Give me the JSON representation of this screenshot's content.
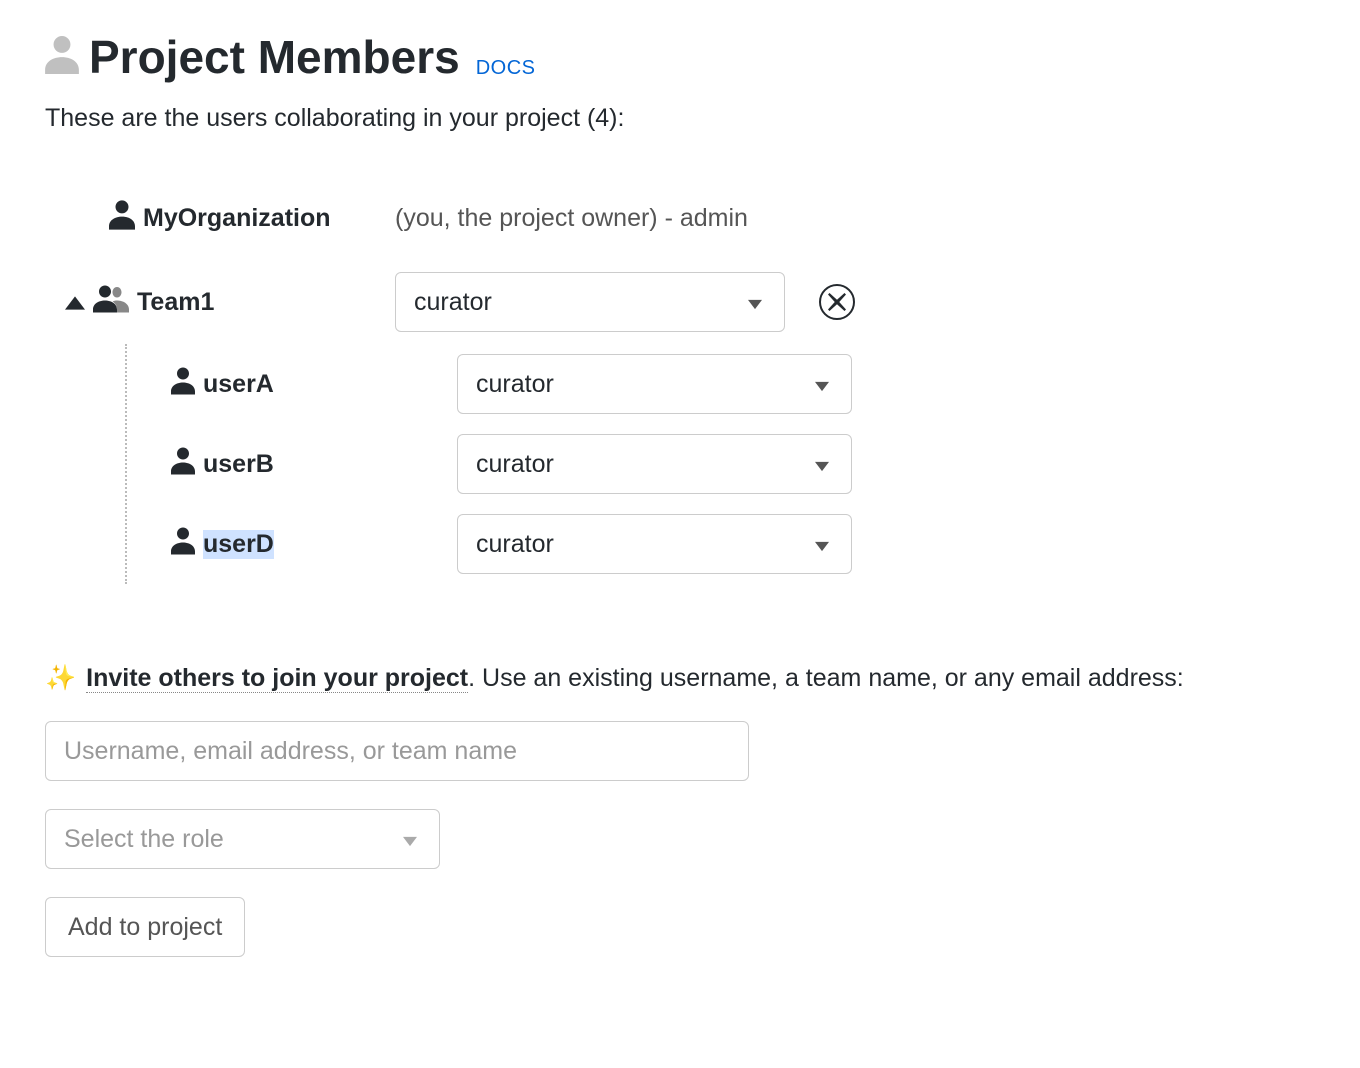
{
  "header": {
    "title": "Project Members",
    "docs_label": "DOCS"
  },
  "subtitle": "These are the users collaborating in your project (4):",
  "owner": {
    "name": "MyOrganization",
    "meta": "(you, the project owner) - admin"
  },
  "team": {
    "name": "Team1",
    "role": "curator",
    "children": [
      {
        "name": "userA",
        "role": "curator",
        "highlighted": false
      },
      {
        "name": "userB",
        "role": "curator",
        "highlighted": false
      },
      {
        "name": "userD",
        "role": "curator",
        "highlighted": true
      }
    ]
  },
  "invite": {
    "heading_strong": "Invite others to join your project",
    "heading_rest": ". Use an existing username, a team name, or any email address:",
    "input_placeholder": "Username, email address, or team name",
    "role_placeholder": "Select the role",
    "add_label": "Add to project"
  }
}
